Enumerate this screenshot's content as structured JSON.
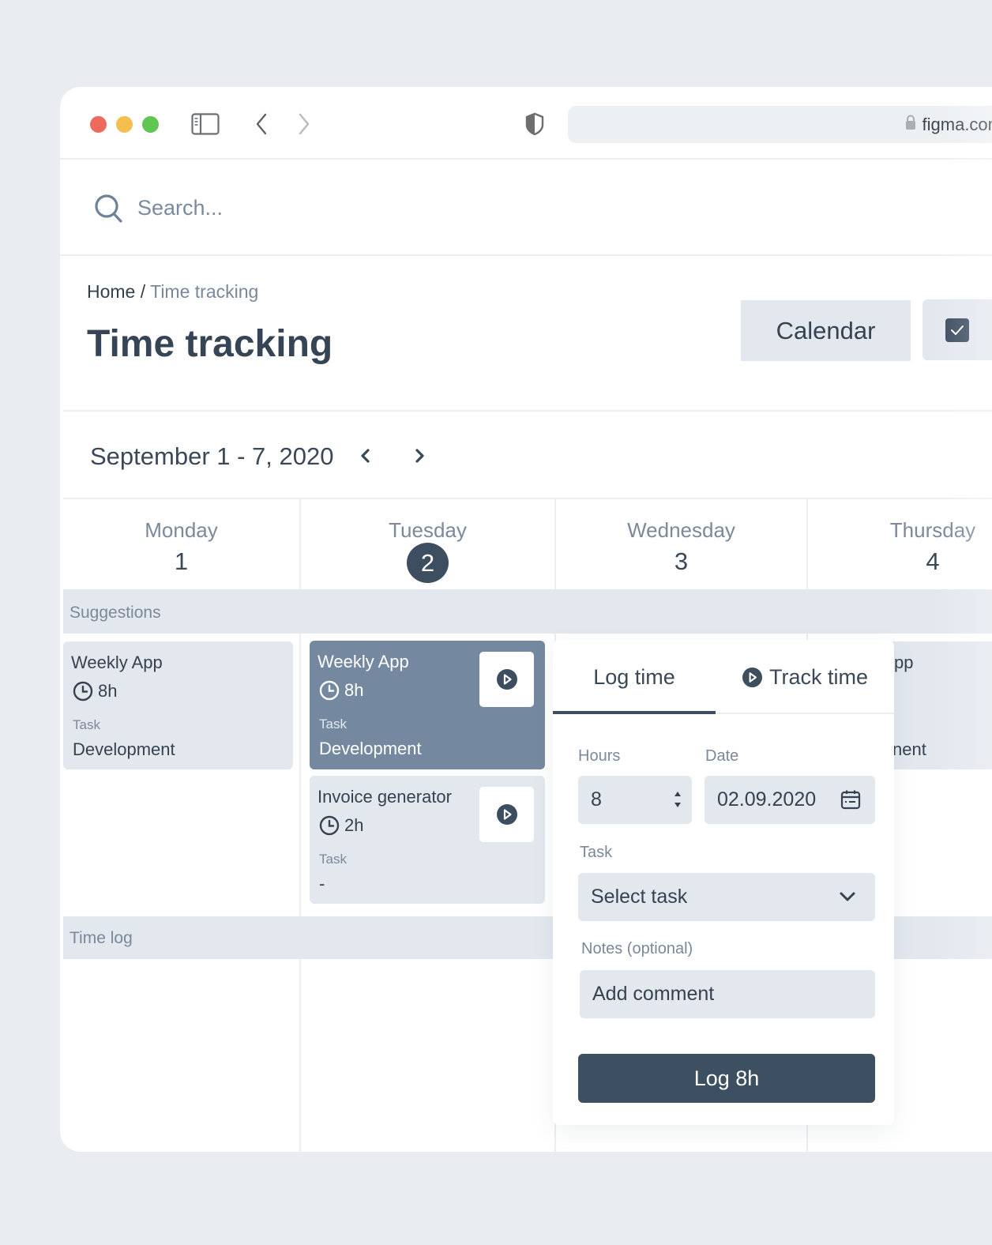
{
  "browser": {
    "url": "figma.com",
    "icons": [
      "sidebar-toggle-icon",
      "chevron-left-icon",
      "chevron-right-icon",
      "shield-icon",
      "lock-icon"
    ]
  },
  "search": {
    "placeholder": "Search..."
  },
  "breadcrumb": {
    "home": "Home",
    "separator": "/",
    "current": "Time tracking"
  },
  "page": {
    "title": "Time tracking"
  },
  "header_actions": {
    "calendar_label": "Calendar",
    "checkbox_checked": true
  },
  "week": {
    "range": "September 1 - 7, 2020"
  },
  "days": [
    {
      "name": "Monday",
      "num": "1",
      "today": false
    },
    {
      "name": "Tuesday",
      "num": "2",
      "today": true
    },
    {
      "name": "Wednesday",
      "num": "3",
      "today": false
    },
    {
      "name": "Thursday",
      "num": "4",
      "today": false
    }
  ],
  "sections": {
    "suggestions": "Suggestions",
    "time_log": "Time log"
  },
  "suggestions": {
    "monday": [
      {
        "project": "Weekly App",
        "duration": "8h",
        "task_label": "Task",
        "task": "Development"
      }
    ],
    "tuesday": [
      {
        "project": "Weekly App",
        "duration": "8h",
        "task_label": "Task",
        "task": "Development",
        "active": true
      },
      {
        "project": "Invoice generator",
        "duration": "2h",
        "task_label": "Task",
        "task": "-"
      }
    ],
    "thursday_partial": {
      "project_fragment": "pp",
      "task_fragment": "nent"
    }
  },
  "popover": {
    "tabs": [
      {
        "label": "Log time",
        "active": true
      },
      {
        "label": "Track time",
        "active": false
      }
    ],
    "hours_label": "Hours",
    "hours_value": "8",
    "date_label": "Date",
    "date_value": "02.09.2020",
    "task_label": "Task",
    "task_placeholder": "Select task",
    "notes_label": "Notes (optional)",
    "notes_placeholder": "Add comment",
    "submit_label": "Log 8h"
  },
  "colors": {
    "primary": "#3d4e60",
    "card_bg": "#e3e8ef",
    "card_active": "#74899f",
    "page_bg": "#e9edf1"
  }
}
